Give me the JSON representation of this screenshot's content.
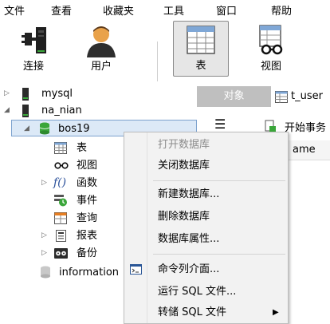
{
  "menubar": [
    "文件",
    "查看",
    "收藏夹",
    "工具",
    "窗口",
    "帮助"
  ],
  "toolbar": {
    "connect": "连接",
    "user": "用户",
    "table": "表",
    "view": "视图"
  },
  "tree": {
    "mysql": "mysql",
    "na_nian": "na_nian",
    "bos19": "bos19",
    "table": "表",
    "view": "视图",
    "func": "函数",
    "event": "事件",
    "query": "查询",
    "report": "报表",
    "backup": "备份",
    "information": "information"
  },
  "right": {
    "tab_objects": "对象",
    "tab_user": "t_user",
    "start_tx": "开始事务",
    "col_name": "ame"
  },
  "context_menu": {
    "open_db": "打开数据库",
    "close_db": "关闭数据库",
    "new_db": "新建数据库...",
    "delete_db": "删除数据库",
    "db_props": "数据库属性...",
    "cmd_console": "命令列介面...",
    "run_sql": "运行 SQL 文件...",
    "dump_sql": "转储 SQL 文件"
  },
  "colors": {
    "accent_green": "#3aa63a",
    "selection": "#dce9f7",
    "tab_gray": "#bfbfbf"
  }
}
